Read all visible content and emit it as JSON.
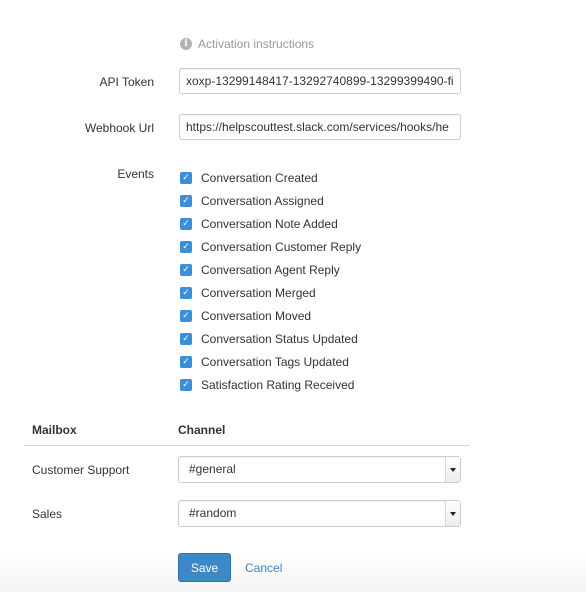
{
  "activation": {
    "icon": "info-icon",
    "text": "Activation instructions"
  },
  "api_token": {
    "label": "API Token",
    "value": "xoxp-13299148417-13292740899-13299399490-fi"
  },
  "webhook": {
    "label": "Webhook Url",
    "value": "https://helpscouttest.slack.com/services/hooks/he"
  },
  "events": {
    "label": "Events",
    "accent_color": "#3b8ed9",
    "items": [
      {
        "label": "Conversation Created",
        "checked": true
      },
      {
        "label": "Conversation Assigned",
        "checked": true
      },
      {
        "label": "Conversation Note Added",
        "checked": true
      },
      {
        "label": "Conversation Customer Reply",
        "checked": true
      },
      {
        "label": "Conversation Agent Reply",
        "checked": true
      },
      {
        "label": "Conversation Merged",
        "checked": true
      },
      {
        "label": "Conversation Moved",
        "checked": true
      },
      {
        "label": "Conversation Status Updated",
        "checked": true
      },
      {
        "label": "Conversation Tags Updated",
        "checked": true
      },
      {
        "label": "Satisfaction Rating Received",
        "checked": true
      }
    ]
  },
  "mapping": {
    "headers": {
      "mailbox": "Mailbox",
      "channel": "Channel"
    },
    "rows": [
      {
        "mailbox": "Customer Support",
        "channel": "#general"
      },
      {
        "mailbox": "Sales",
        "channel": "#random"
      }
    ]
  },
  "actions": {
    "save_label": "Save",
    "cancel_label": "Cancel",
    "save_color": "#3d88c6"
  }
}
